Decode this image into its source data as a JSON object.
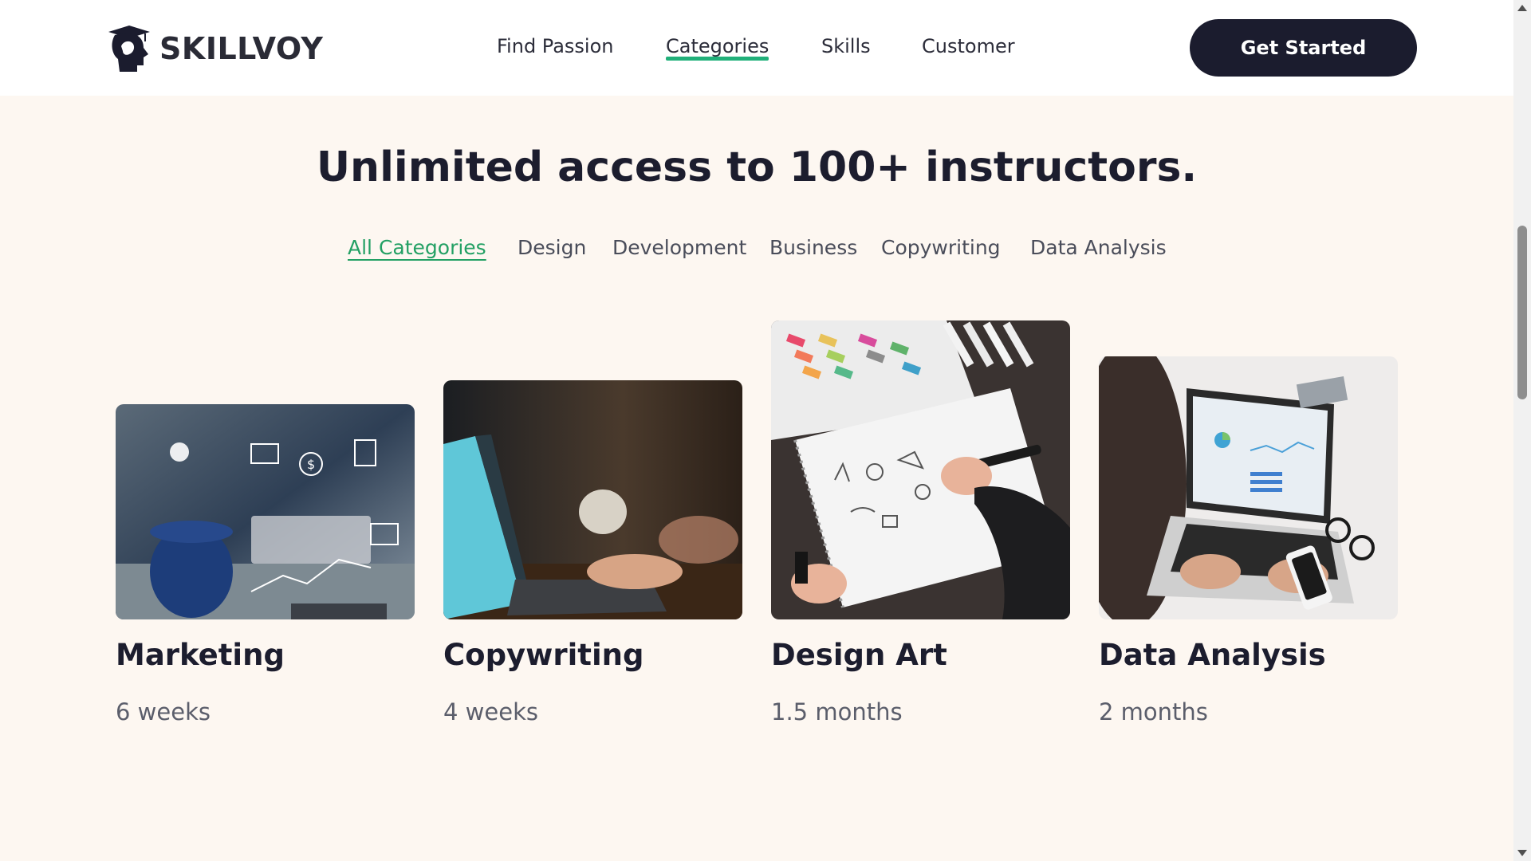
{
  "brand": {
    "name": "SKILLVOY",
    "icon": "graduate-head-icon"
  },
  "nav": {
    "items": [
      {
        "label": "Find Passion",
        "active": false
      },
      {
        "label": "Categories",
        "active": true
      },
      {
        "label": "Skills",
        "active": false
      },
      {
        "label": "Customer",
        "active": false
      }
    ],
    "cta_label": "Get Started"
  },
  "hero": {
    "title": "Unlimited access to 100+ instructors."
  },
  "categories": [
    {
      "label": "All Categories",
      "active": true
    },
    {
      "label": "Design",
      "active": false
    },
    {
      "label": "Development",
      "active": false
    },
    {
      "label": "Business",
      "active": false
    },
    {
      "label": "Copywriting",
      "active": false
    },
    {
      "label": "Data Analysis",
      "active": false
    }
  ],
  "courses": [
    {
      "title": "Marketing",
      "duration": "6 weeks",
      "image": "marketing-photo"
    },
    {
      "title": "Copywriting",
      "duration": "4 weeks",
      "image": "copywriting-photo"
    },
    {
      "title": "Design Art",
      "duration": "1.5 months",
      "image": "design-art-photo"
    },
    {
      "title": "Data Analysis",
      "duration": "2 months",
      "image": "data-analysis-photo"
    }
  ],
  "colors": {
    "accent": "#23a064",
    "dark": "#1b1c2e",
    "background": "#fdf7f1"
  }
}
